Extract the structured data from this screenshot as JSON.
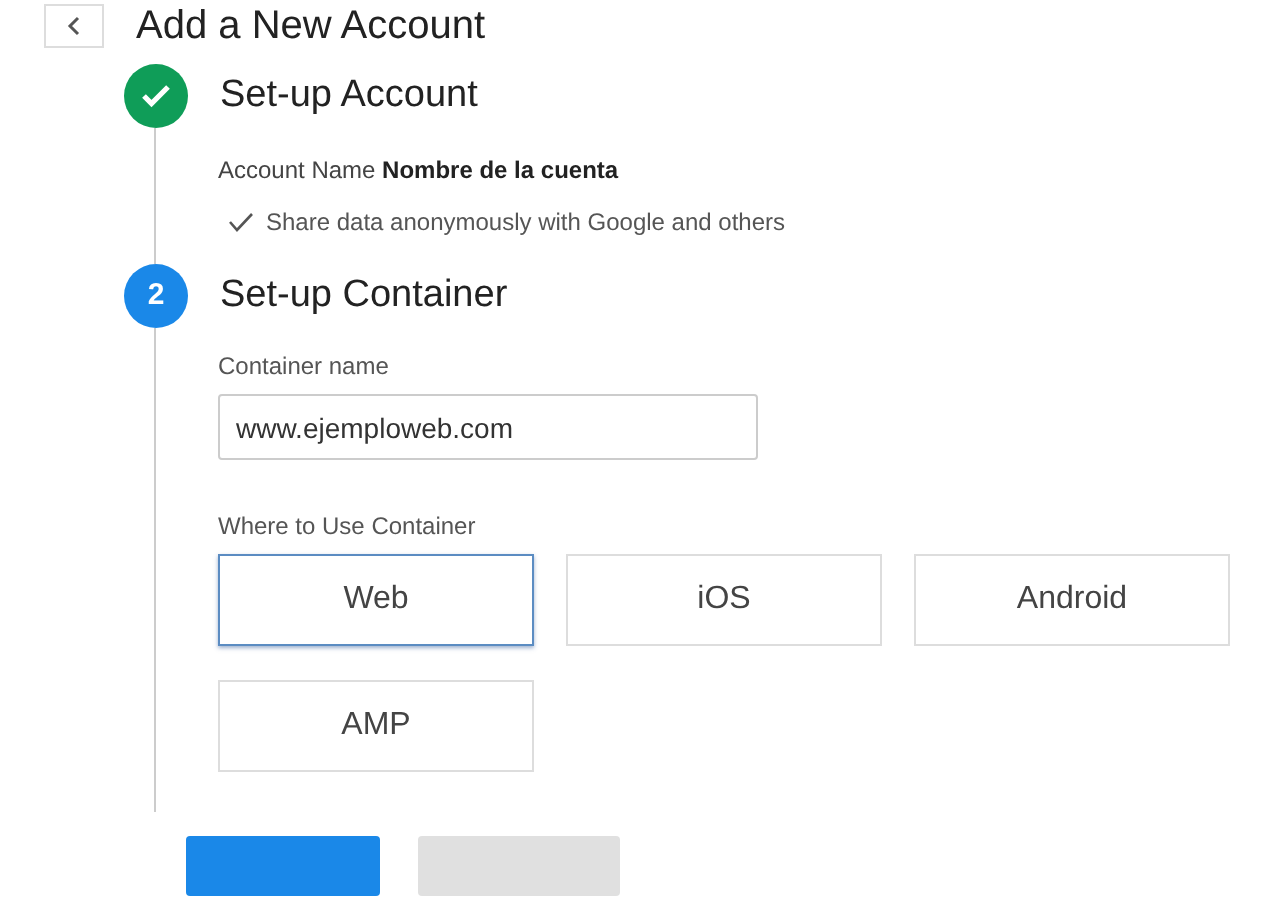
{
  "header": {
    "title": "Add a New Account"
  },
  "steps": [
    {
      "kind": "done",
      "title": "Set-up Account",
      "account_label": "Account Name",
      "account_value": "Nombre de la cuenta",
      "share": {
        "checked": true,
        "label": "Share data anonymously with Google and others"
      }
    },
    {
      "kind": "active",
      "number": "2",
      "title": "Set-up Container",
      "field_label": "Container name",
      "field_value": "www.ejemploweb.com",
      "platform_label": "Where to Use Container",
      "platforms": [
        {
          "label": "Web",
          "selected": true
        },
        {
          "label": "iOS",
          "selected": false
        },
        {
          "label": "Android",
          "selected": false
        },
        {
          "label": "AMP",
          "selected": false
        }
      ]
    }
  ]
}
